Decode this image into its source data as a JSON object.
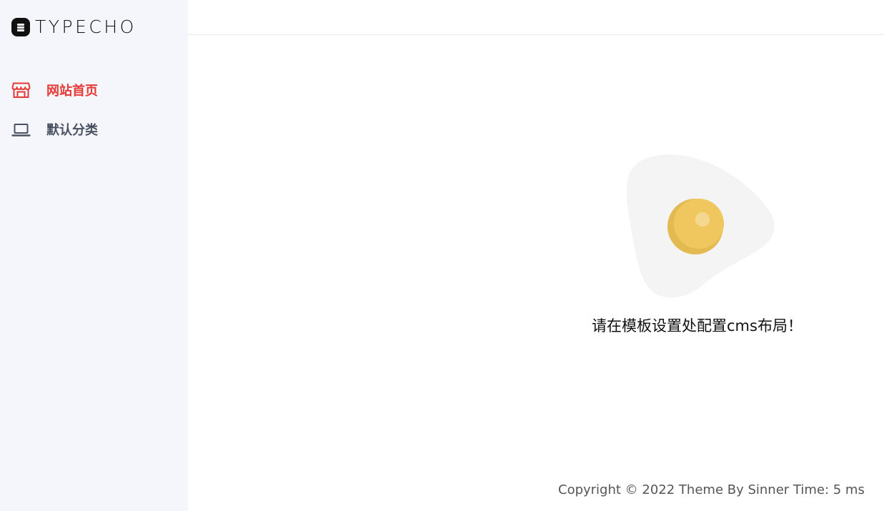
{
  "brand": {
    "name": "TYPECHO"
  },
  "sidebar": {
    "items": [
      {
        "label": "网站首页",
        "icon": "store-icon",
        "active": true,
        "color": "#e53935"
      },
      {
        "label": "默认分类",
        "icon": "laptop-icon",
        "active": false,
        "color": "#4a5160"
      }
    ]
  },
  "main": {
    "empty_state": {
      "icon": "fried-egg-icon",
      "message": "请在模板设置处配置cms布局！"
    }
  },
  "footer": {
    "text": "Copyright © 2022 Theme By Sinner Time: 5 ms"
  },
  "colors": {
    "sidebar_bg": "#f5f6fb",
    "accent": "#e53935",
    "egg_yolk": "#f0c75e"
  }
}
